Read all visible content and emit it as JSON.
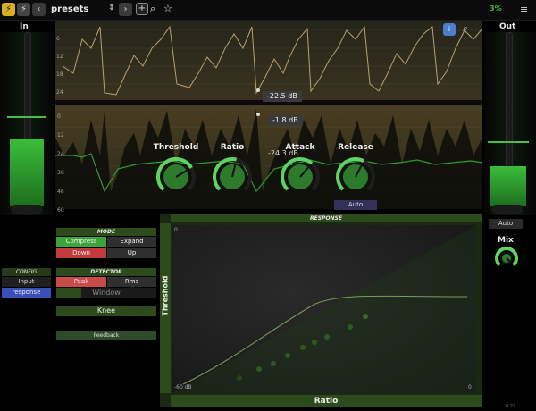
{
  "colors": {
    "accent": "#3aa53a",
    "graph": "#2a2a1a",
    "dark": "#111111",
    "red": "#c23a3a",
    "blue": "#3a4fb8"
  },
  "top": {
    "preset_name": "presets",
    "cpu": "3%"
  },
  "meters": {
    "in_label": "In",
    "out_label": "Out",
    "in_level": 0.35,
    "out_level": 0.28
  },
  "graph": {
    "scale_top": [
      "6",
      "12",
      "18",
      "24"
    ],
    "scale_bottom": [
      "0",
      "12",
      "24",
      "36",
      "48",
      "60"
    ],
    "readout_1": "-22.5 dB",
    "readout_2": "-1.8 dB",
    "readout_3": "-24.3 dB"
  },
  "knobs": [
    {
      "label": "Threshold",
      "value": 0.72
    },
    {
      "label": "Ratio",
      "value": 0.55
    },
    {
      "label": "Attack",
      "value": 0.65
    },
    {
      "label": "Release",
      "value": 0.6
    }
  ],
  "release_auto": "Auto",
  "out_auto": "Auto",
  "mix_label": "Mix",
  "mode": {
    "title": "MODE",
    "compress": "Compress",
    "expand": "Expand",
    "down": "Down",
    "up": "Up"
  },
  "detector": {
    "title": "DETECTOR",
    "peak": "Peak",
    "rms": "Rms",
    "window": "Window",
    "knee": "Knee",
    "feedback": "Feedback"
  },
  "config": {
    "title": "CONFIG",
    "input": "Input",
    "response": "response"
  },
  "response": {
    "title": "RESPONSE",
    "ylabel": "Threshold",
    "xlabel": "Ratio",
    "y_top": "0",
    "x_left": "-60 dB",
    "x_right": "0"
  },
  "version": "0.22 ..."
}
